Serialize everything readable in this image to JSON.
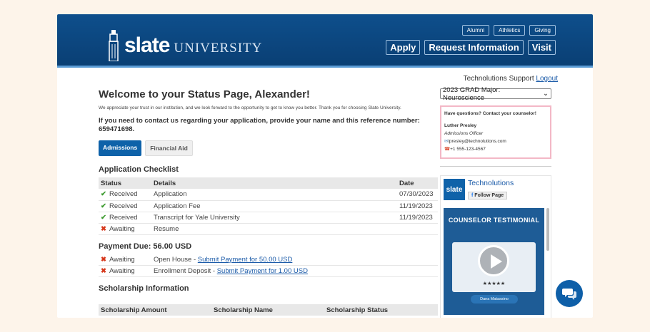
{
  "header": {
    "logo_slate": "slate",
    "logo_university": "UNIVERSITY",
    "top_links": [
      "Alumni",
      "Athletics",
      "Giving"
    ],
    "main_links": [
      "Apply",
      "Request Information",
      "Visit"
    ]
  },
  "support": {
    "user": "Technolutions Support",
    "logout": "Logout"
  },
  "page": {
    "title": "Welcome to your Status Page, Alexander!",
    "intro": "We appreciate your trust in our institution, and we look forward to the opportunity to get to know you better. Thank you for choosing Slate University.",
    "contact_note": "If you need to contact us regarding your application, provide your name and this reference number: 659471698.",
    "tabs": [
      "Admissions",
      "Financial Aid"
    ]
  },
  "checklist": {
    "title": "Application Checklist",
    "headers": [
      "Status",
      "Details",
      "Date"
    ],
    "rows": [
      {
        "status": "Received",
        "details": "Application",
        "date": "07/30/2023"
      },
      {
        "status": "Received",
        "details": "Application Fee",
        "date": "11/19/2023"
      },
      {
        "status": "Received",
        "details": "Transcript for Yale University",
        "date": "11/19/2023"
      },
      {
        "status": "Awaiting",
        "details": "Resume",
        "date": ""
      }
    ]
  },
  "payment": {
    "title": "Payment Due: 56.00 USD",
    "rows": [
      {
        "status": "Awaiting",
        "details": "Open House - ",
        "link": "Submit Payment for 50.00 USD"
      },
      {
        "status": "Awaiting",
        "details": "Enrollment Deposit - ",
        "link": "Submit Payment for 1.00 USD"
      }
    ]
  },
  "scholarship": {
    "title": "Scholarship Information",
    "headers": [
      "Scholarship Amount",
      "Scholarship Name",
      "Scholarship Status"
    ]
  },
  "sidebar": {
    "select_value": "2023 GRAD Major: Neuroscience",
    "counselor": {
      "heading": "Have questions?  Contact your counselor!",
      "name": "Luther Presley",
      "role": "Admissions Officer",
      "email": "lpresley@technolutions.com",
      "phone": "+1 555-123-4567"
    },
    "fb": {
      "logo": "slate",
      "name": "Technolutions",
      "follow": "Follow Page",
      "video_title": "COUNSELOR TESTIMONIAL",
      "stars": "★★★★★",
      "person": "Dana Matassino"
    }
  },
  "colors": {
    "brand": "#0e4f8c",
    "accent": "#0e62a9",
    "received": "#3c9a2e",
    "awaiting": "#d6381c"
  }
}
